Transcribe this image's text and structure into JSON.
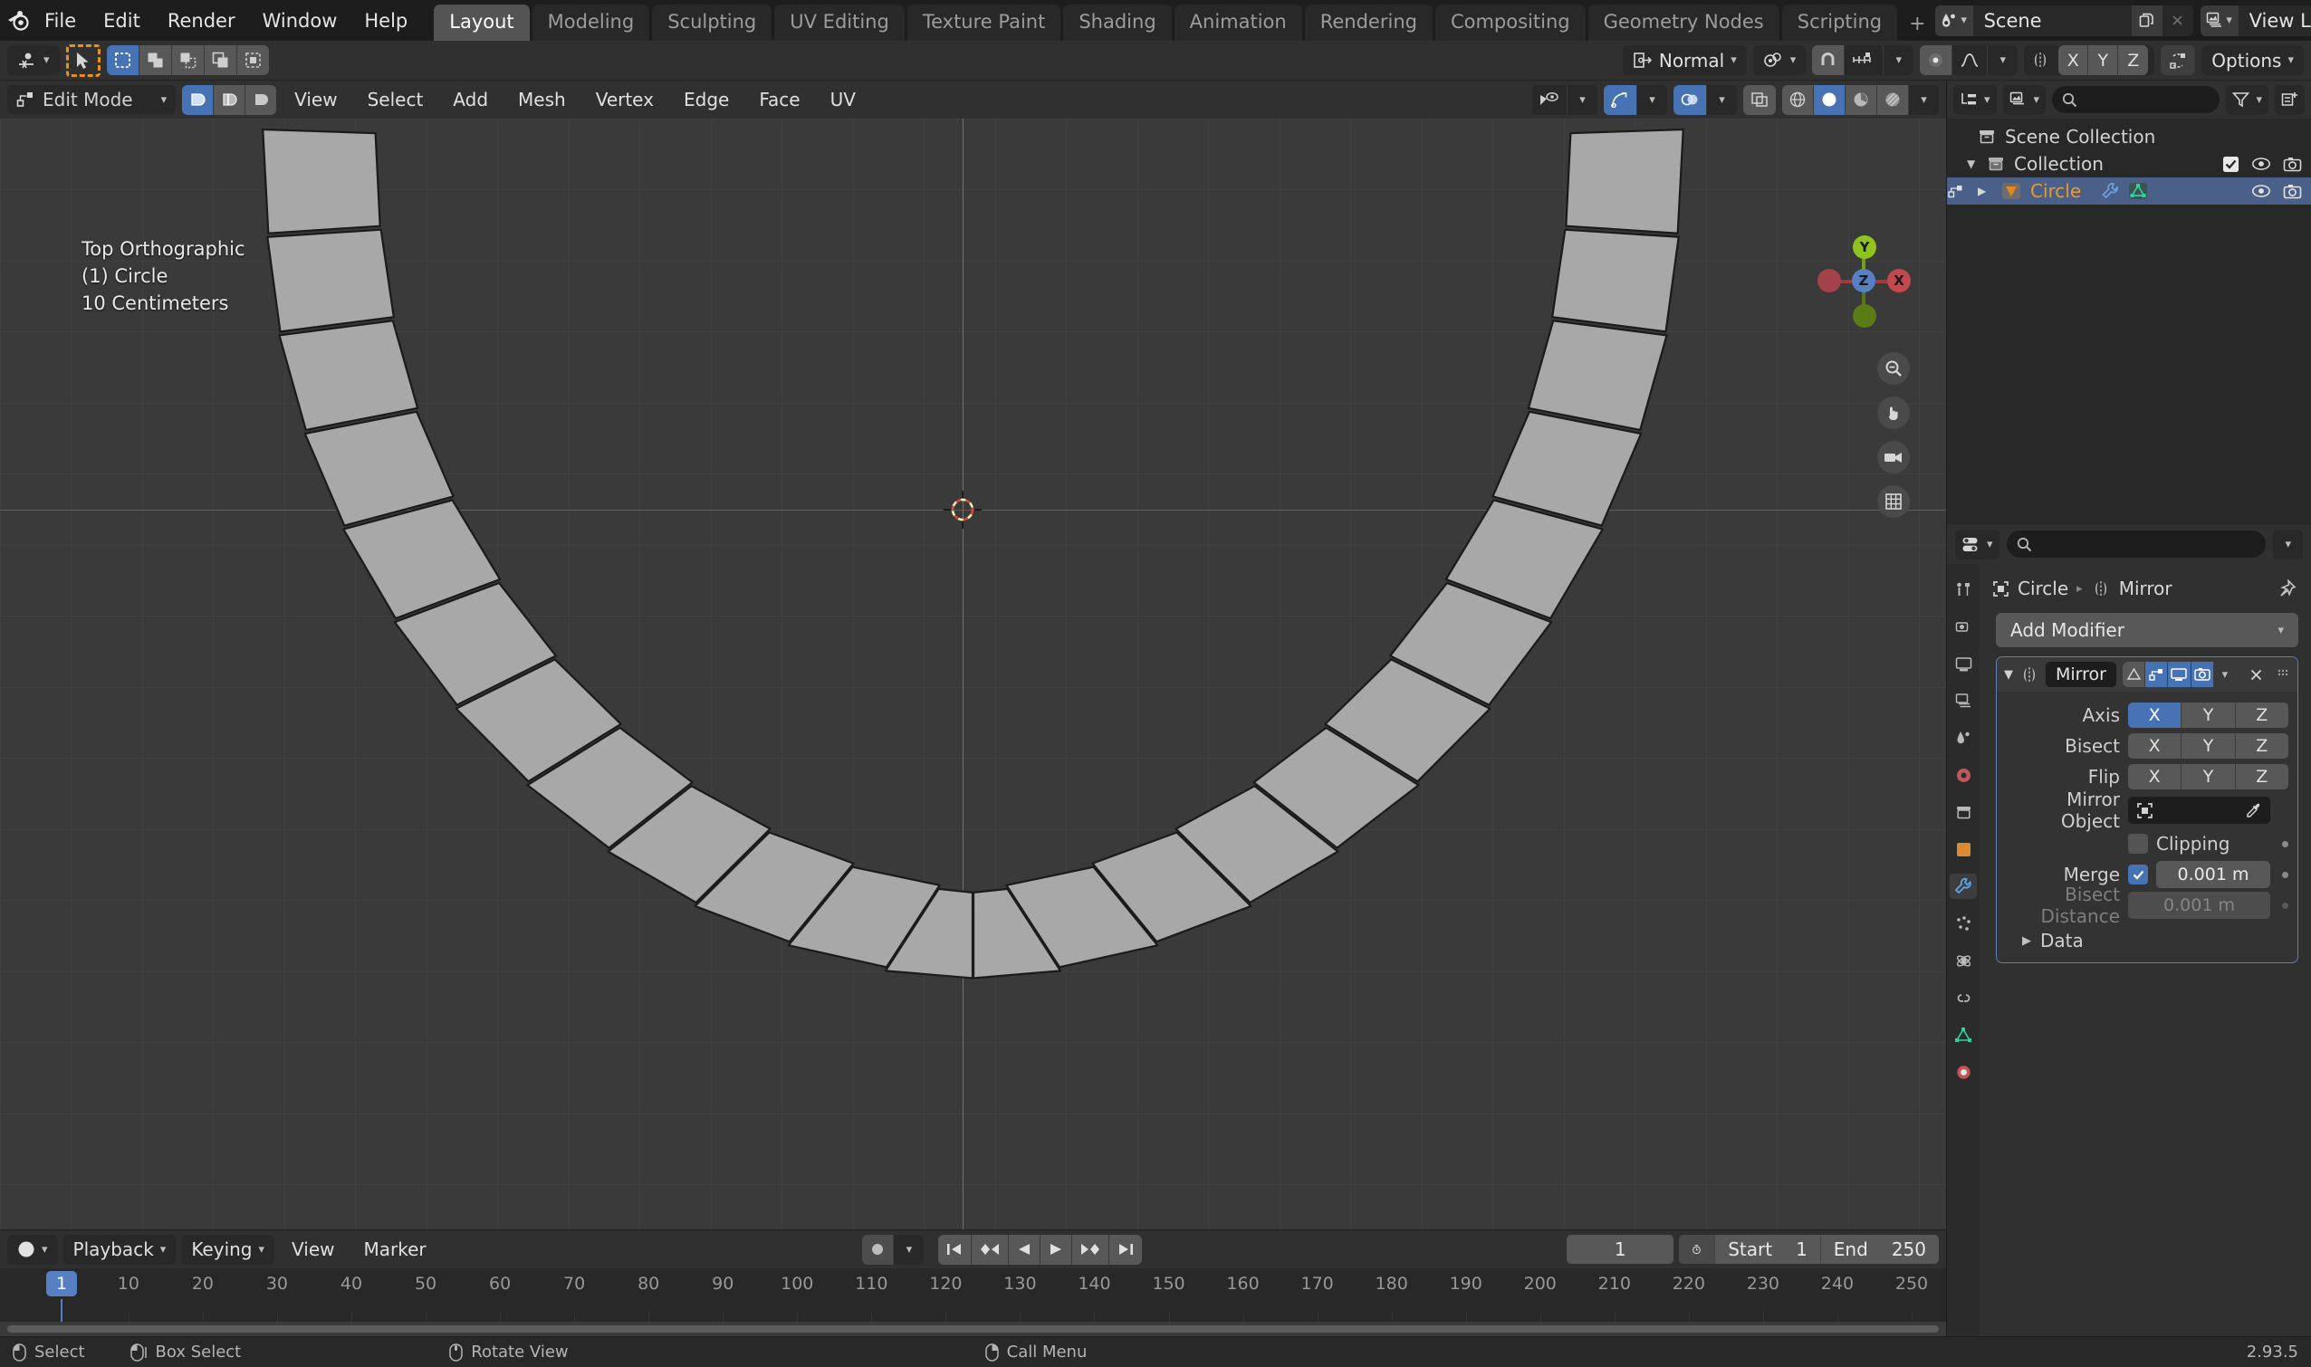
{
  "app": {
    "name": "Blender",
    "logo_icon": "blender-logo-icon"
  },
  "topbar": {
    "menus": [
      "File",
      "Edit",
      "Render",
      "Window",
      "Help"
    ],
    "workspaces": [
      {
        "label": "Layout",
        "active": true
      },
      {
        "label": "Modeling",
        "active": false
      },
      {
        "label": "Sculpting",
        "active": false
      },
      {
        "label": "UV Editing",
        "active": false
      },
      {
        "label": "Texture Paint",
        "active": false
      },
      {
        "label": "Shading",
        "active": false
      },
      {
        "label": "Animation",
        "active": false
      },
      {
        "label": "Rendering",
        "active": false
      },
      {
        "label": "Compositing",
        "active": false
      },
      {
        "label": "Geometry Nodes",
        "active": false
      },
      {
        "label": "Scripting",
        "active": false
      }
    ],
    "add_workspace_label": "+",
    "scene": {
      "icon": "scene-icon",
      "name": "Scene",
      "new_icon": "duplicate-icon",
      "remove_icon": "x-icon"
    },
    "view_layer": {
      "icon": "view-layer-icon",
      "name": "View Layer",
      "new_icon": "duplicate-icon",
      "remove_icon": "x-icon"
    }
  },
  "toolrow": {
    "editor_type_icon": "editor-type-icon",
    "cursor_tool_icon": "cursor-select-icon",
    "select_modes": [
      {
        "name": "select-set-icon",
        "active": true
      },
      {
        "name": "select-extend-icon",
        "active": false
      },
      {
        "name": "select-subtract-icon",
        "active": false
      },
      {
        "name": "select-invert-icon",
        "active": false
      },
      {
        "name": "select-intersect-icon",
        "active": false
      }
    ],
    "transform_orientation": {
      "icon": "orientation-icon",
      "value": "Normal"
    },
    "pivot_point": {
      "icon": "pivot-icon"
    },
    "snap": {
      "magnet_icon": "magnet-icon",
      "snap_to_icon": "snap-increment-icon",
      "enabled": true
    },
    "proportional_edit": {
      "icon": "proportional-icon",
      "falloff_icon": "falloff-smooth-icon",
      "enabled": true
    },
    "mirror": {
      "icon": "mirror-icon",
      "axes": [
        "X",
        "Y",
        "Z"
      ]
    },
    "auto_merge_icon": "auto-merge-icon",
    "options_label": "Options"
  },
  "viewport_header": {
    "mode": "Edit Mode",
    "mesh_select_modes": [
      {
        "name": "vertex-select-icon",
        "active": true
      },
      {
        "name": "edge-select-icon",
        "active": false
      },
      {
        "name": "face-select-icon",
        "active": false
      }
    ],
    "menus": [
      "View",
      "Select",
      "Add",
      "Mesh",
      "Vertex",
      "Edge",
      "Face",
      "UV"
    ],
    "right_controls": [
      {
        "name": "visibility-icon",
        "active": false
      },
      {
        "name": "gizmo-icon",
        "active": true
      },
      {
        "name": "overlays-icon",
        "active": true
      },
      {
        "name": "xray-toggle-icon",
        "active": false
      }
    ],
    "shading_modes": [
      {
        "name": "wireframe-shading-icon",
        "active": false
      },
      {
        "name": "solid-shading-icon",
        "active": true
      },
      {
        "name": "material-preview-shading-icon",
        "active": false
      },
      {
        "name": "rendered-shading-icon",
        "active": false
      }
    ]
  },
  "viewport": {
    "overlay_lines": [
      "Top Orthographic",
      "(1) Circle",
      "10 Centimeters"
    ],
    "gizmo": {
      "axes": [
        {
          "label": "Y",
          "color": "#8fc31f"
        },
        {
          "label": "Z",
          "color": "#5680c2"
        },
        {
          "label": "X",
          "color": "#c4484e"
        }
      ]
    },
    "nav_buttons": [
      "zoom-icon",
      "pan-hand-icon",
      "camera-view-icon",
      "toggle-ortho-grid-icon"
    ],
    "colors": {
      "background": "#3a3a3a",
      "grid": "#454545",
      "x_axis": "#8b4a4f",
      "y_axis": "#4a8b4f",
      "mesh_fill": "#a8a8a8",
      "mesh_edge": "#1b1b1b"
    }
  },
  "outliner": {
    "display_mode_icon": "outliner-display-icon",
    "filter_type_icon": "view-layer-icon",
    "search_placeholder": "",
    "filter_icon": "filter-funnel-icon",
    "new_collection_icon": "new-collection-icon",
    "rows": [
      {
        "label": "Scene Collection",
        "icon": "collection-icon",
        "indent": 0,
        "selected": false,
        "expander": "",
        "has_toggles": false
      },
      {
        "label": "Collection",
        "icon": "collection-icon",
        "indent": 1,
        "selected": false,
        "expander": "▼",
        "has_toggles": true,
        "checkbox": true
      },
      {
        "label": "Circle",
        "icon": "mesh-object-icon",
        "indent": 2,
        "selected": true,
        "expander": "▶",
        "has_toggles": true,
        "checkbox": false,
        "data_icons": [
          "modifier-wrench-icon",
          "mesh-data-icon"
        ]
      }
    ],
    "toggle_icons": [
      "eye-icon",
      "camera-icon"
    ]
  },
  "properties": {
    "editor_icon": "properties-editor-icon",
    "search_placeholder": "",
    "breadcrumb": {
      "object_icon": "object-icon",
      "object_name": "Circle",
      "separator": "▸",
      "modifier_icon": "mirror-modifier-icon",
      "modifier_name": "Mirror",
      "pin_icon": "pin-icon"
    },
    "tabs": [
      {
        "name": "tool-tab-icon",
        "active": false
      },
      {
        "name": "render-tab-icon",
        "active": false
      },
      {
        "name": "output-tab-icon",
        "active": false
      },
      {
        "name": "view-layer-tab-icon",
        "active": false
      },
      {
        "name": "scene-tab-icon",
        "active": false
      },
      {
        "name": "world-tab-icon",
        "active": false
      },
      {
        "name": "collection-tab-icon",
        "active": false
      },
      {
        "name": "object-tab-icon",
        "active": false
      },
      {
        "name": "modifier-tab-icon",
        "active": true
      },
      {
        "name": "particles-tab-icon",
        "active": false
      },
      {
        "name": "physics-tab-icon",
        "active": false
      },
      {
        "name": "constraints-tab-icon",
        "active": false
      },
      {
        "name": "data-tab-icon",
        "active": false
      },
      {
        "name": "material-tab-icon",
        "active": false
      }
    ],
    "add_modifier_label": "Add Modifier",
    "modifier": {
      "expander": "▼",
      "icon": "mirror-modifier-icon",
      "name": "Mirror",
      "header_toggles": [
        {
          "name": "on-cage-icon",
          "active": false
        },
        {
          "name": "edit-mode-display-icon",
          "active": true
        },
        {
          "name": "realtime-display-icon",
          "active": true
        },
        {
          "name": "render-display-icon",
          "active": true
        }
      ],
      "extras_icon": "chevron-down-icon",
      "close_icon": "x-icon",
      "drag_icon": "drag-dots-icon",
      "rows": [
        {
          "label": "Axis",
          "type": "toggles",
          "options": [
            "X",
            "Y",
            "Z"
          ],
          "active": [
            true,
            false,
            false
          ]
        },
        {
          "label": "Bisect",
          "type": "toggles",
          "options": [
            "X",
            "Y",
            "Z"
          ],
          "active": [
            false,
            false,
            false
          ]
        },
        {
          "label": "Flip",
          "type": "toggles",
          "options": [
            "X",
            "Y",
            "Z"
          ],
          "active": [
            false,
            false,
            false
          ]
        }
      ],
      "mirror_object": {
        "label": "Mirror Object",
        "value": "",
        "icon": "object-icon",
        "eyedropper_icon": "eyedropper-icon"
      },
      "clipping": {
        "label": "Clipping",
        "checked": false
      },
      "merge": {
        "label": "Merge",
        "checked": true,
        "value": "0.001 m"
      },
      "bisect_distance": {
        "label": "Bisect Distance",
        "value": "0.001 m",
        "disabled": true
      },
      "data_section": {
        "label": "Data",
        "expander": "▶",
        "expanded": false
      }
    }
  },
  "timeline": {
    "editor_icon": "timeline-editor-icon",
    "menus": [
      "Playback",
      "Keying",
      "View",
      "Marker"
    ],
    "auto_key_icon": "record-icon",
    "transport": [
      "jump-to-start-icon",
      "prev-keyframe-icon",
      "play-reverse-icon",
      "play-icon",
      "next-keyframe-icon",
      "jump-to-end-icon"
    ],
    "current_frame": "1",
    "use_preview_range_icon": "stopwatch-icon",
    "start": {
      "label": "Start",
      "value": "1"
    },
    "end": {
      "label": "End",
      "value": "250"
    },
    "ruler_ticks": [
      "10",
      "20",
      "30",
      "40",
      "50",
      "60",
      "70",
      "80",
      "90",
      "100",
      "110",
      "120",
      "130",
      "140",
      "150",
      "160",
      "170",
      "180",
      "190",
      "200",
      "210",
      "220",
      "230",
      "240",
      "250"
    ],
    "playhead_label": "1"
  },
  "statusbar": {
    "items": [
      {
        "icon": "mouse-left-icon",
        "label": "Select"
      },
      {
        "icon": "mouse-left-drag-icon",
        "label": "Box Select"
      },
      {
        "icon": "mouse-middle-icon",
        "label": "Rotate View"
      },
      {
        "icon": "mouse-right-icon",
        "label": "Call Menu"
      }
    ],
    "version": "2.93.5"
  }
}
